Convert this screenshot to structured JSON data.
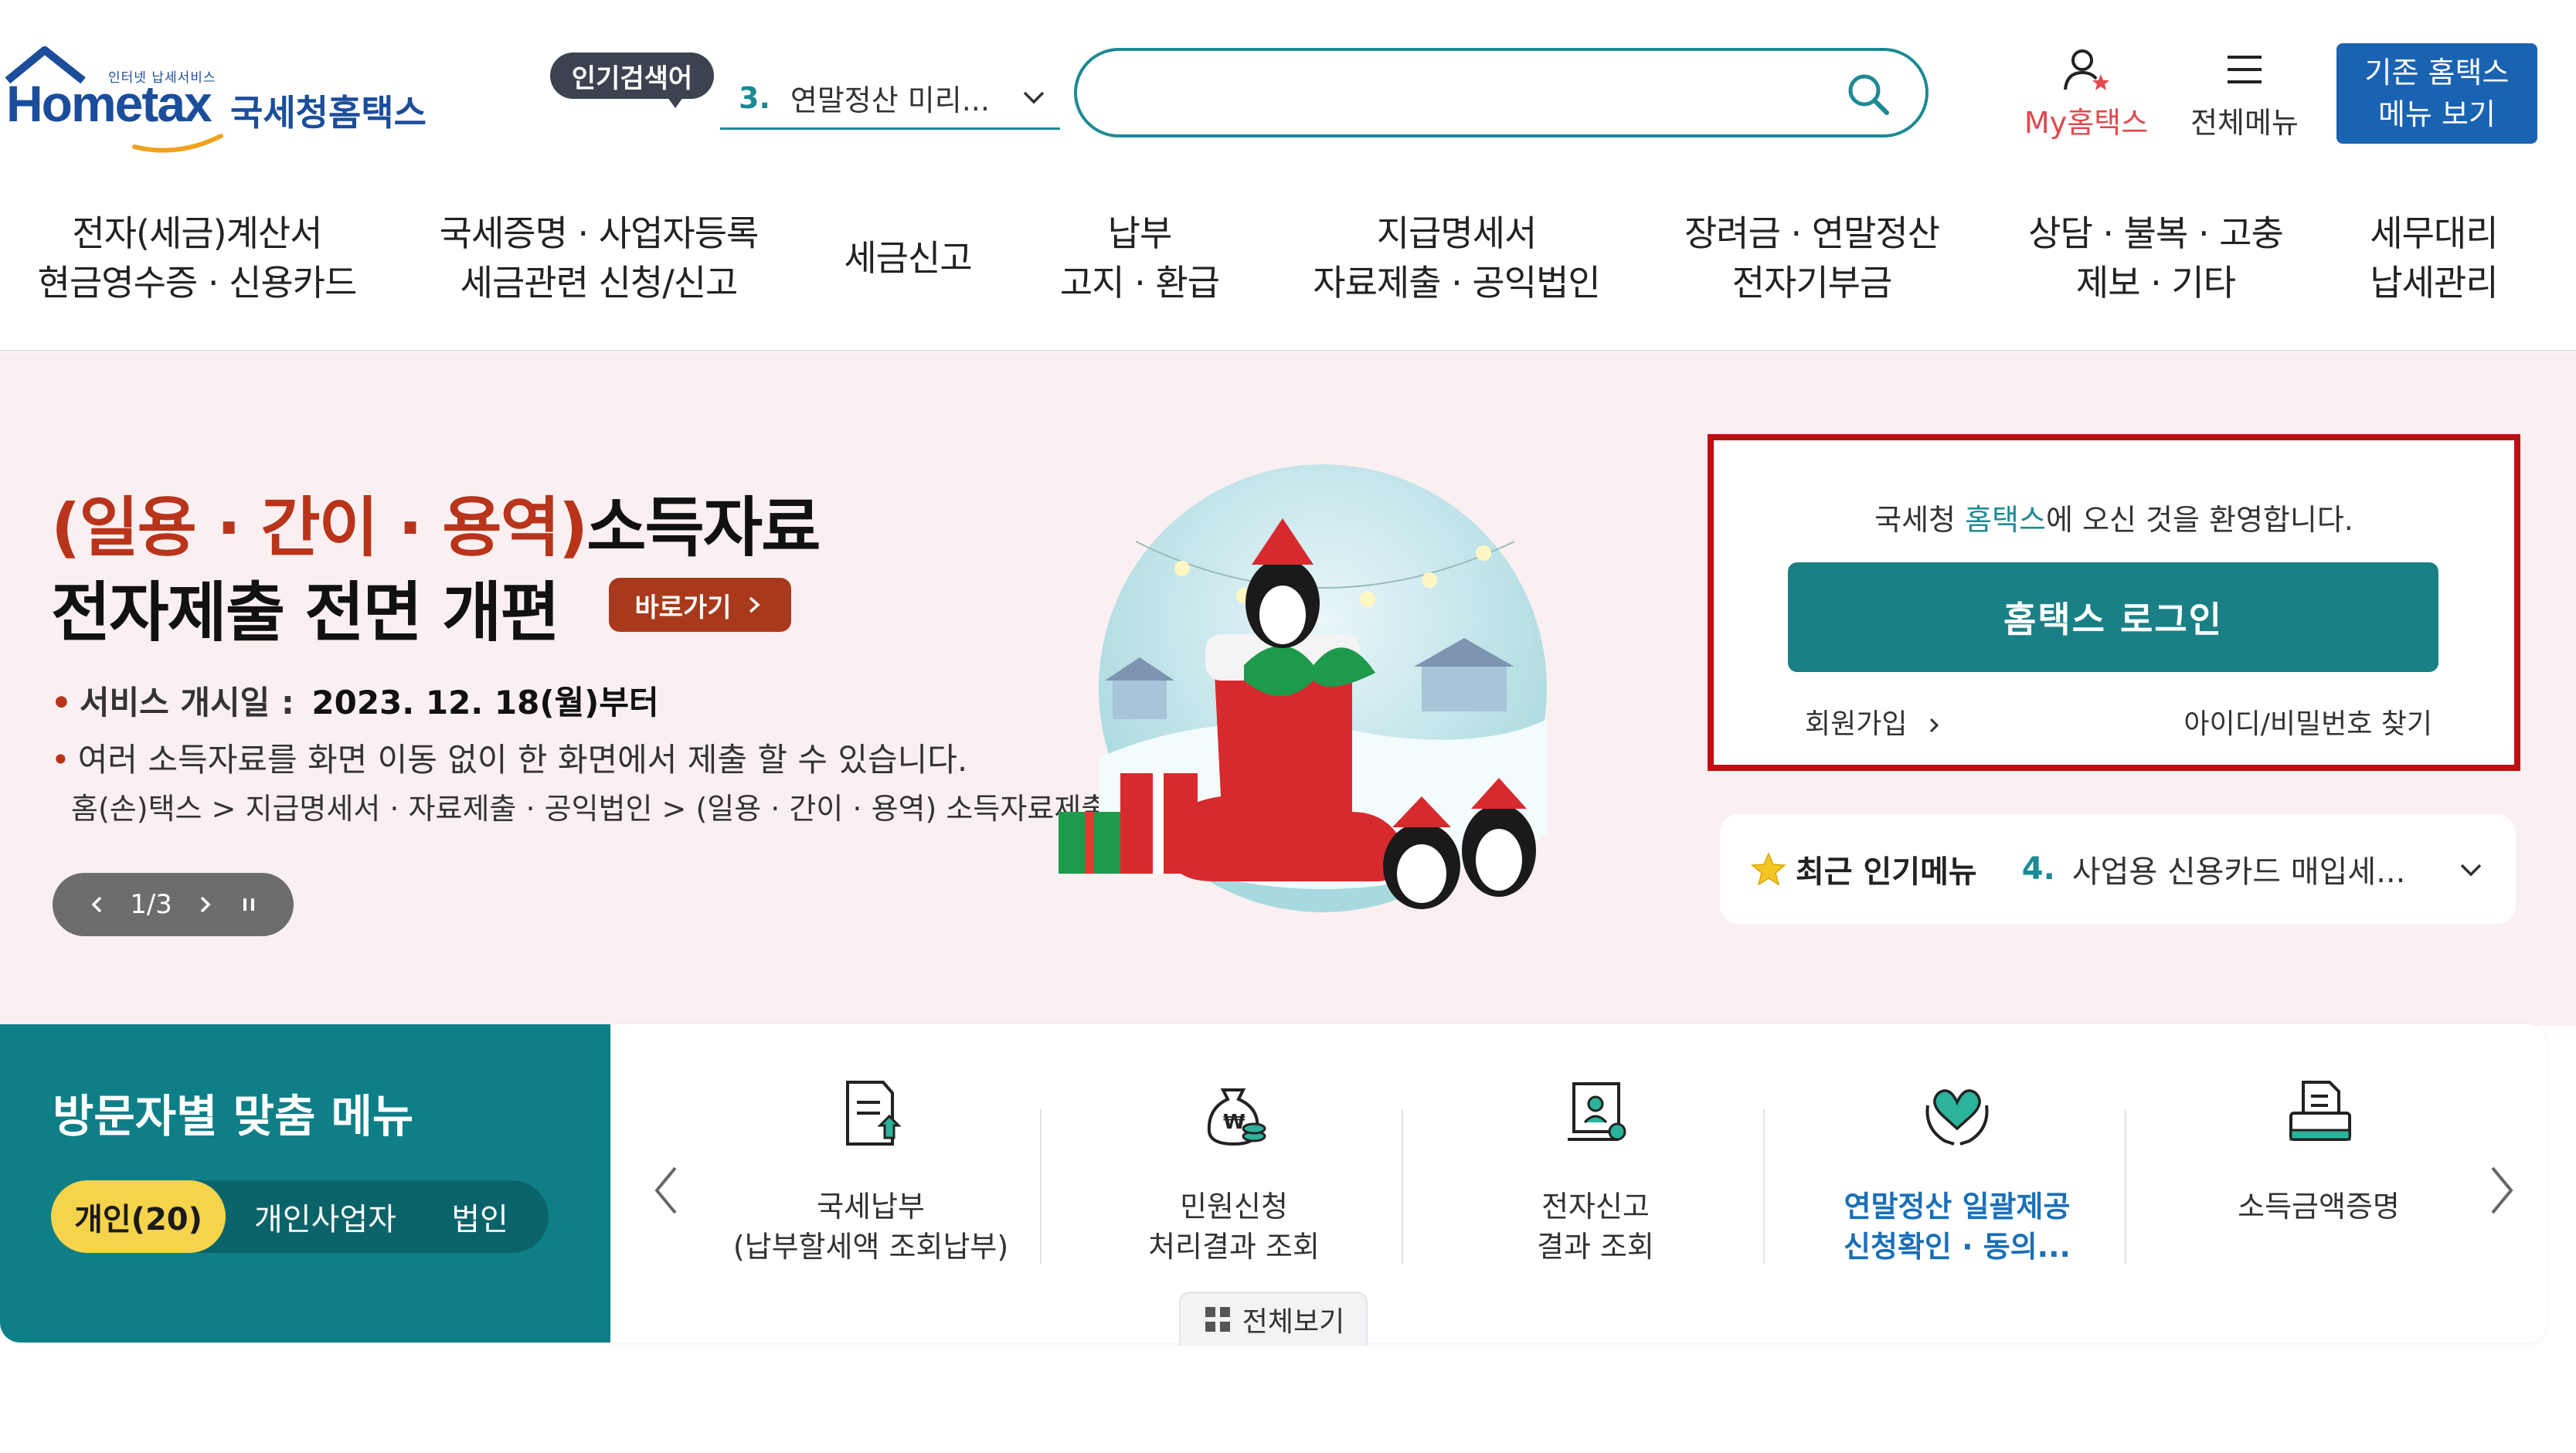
{
  "header": {
    "logo_small": "인터넷 납세서비스",
    "logo_word": "Hometax",
    "logo_name": "국세청홈택스",
    "popular_badge": "인기검색어",
    "popular_rank": "3.",
    "popular_text": "연말정산 미리...",
    "search_placeholder": "",
    "my_hometax": "My홈택스",
    "all_menu": "전체메뉴",
    "legacy_line1": "기존 홈택스",
    "legacy_line2": "메뉴 보기"
  },
  "gnb": [
    {
      "l1": "전자(세금)계산서",
      "l2": "현금영수증 · 신용카드"
    },
    {
      "l1": "국세증명 · 사업자등록",
      "l2": "세금관련 신청/신고"
    },
    {
      "l1": "세금신고",
      "l2": ""
    },
    {
      "l1": "납부",
      "l2": "고지 · 환급"
    },
    {
      "l1": "지급명세서",
      "l2": "자료제출 · 공익법인"
    },
    {
      "l1": "장려금 · 연말정산",
      "l2": "전자기부금"
    },
    {
      "l1": "상담 · 불복 · 고충",
      "l2": "제보 · 기타"
    },
    {
      "l1": "세무대리",
      "l2": "납세관리"
    }
  ],
  "hero": {
    "title_accent": "(일용 · 간이 · 용역)",
    "title_rest": "소득자료",
    "title_line2": "전자제출 전면 개편",
    "go_button": "바로가기",
    "bullet1_label": "서비스 개시일 :",
    "bullet1_date": "2023. 12. 18(월)부터",
    "bullet2": "여러 소득자료를 화면 이동 없이 한 화면에서 제출 할 수 있습니다.",
    "path": "홈(손)택스 > 지급명세서 · 자료제출 · 공익법인 > (일용 · 간이 · 용역) 소득자료제출",
    "slide_indicator": "1/3"
  },
  "login": {
    "welcome_pre": "국세청 ",
    "welcome_hl": "홈택스",
    "welcome_post": "에 오신 것을 환영합니다.",
    "login_button": "홈택스 로그인",
    "join": "회원가입",
    "find": "아이디/비밀번호 찾기",
    "highlight_color": "#c00e13"
  },
  "recent": {
    "title": "최근 인기메뉴",
    "rank": "4.",
    "text": "사업용 신용카드 매입세..."
  },
  "visitor": {
    "title": "방문자별 맞춤 메뉴",
    "tabs": [
      "개인(20)",
      "개인사업자",
      "법인"
    ],
    "active_tab": 0
  },
  "quick_menu": [
    {
      "icon": "tax-payment-icon",
      "l1": "국세납부",
      "l2": "(납부할세액 조회납부)",
      "highlight": false
    },
    {
      "icon": "money-bag-icon",
      "l1": "민원신청",
      "l2": "처리결과 조회",
      "highlight": false
    },
    {
      "icon": "e-filing-icon",
      "l1": "전자신고",
      "l2": "결과 조회",
      "highlight": false
    },
    {
      "icon": "heart-hands-icon",
      "l1": "연말정산 일괄제공",
      "l2": "신청확인 · 동의...",
      "highlight": true
    },
    {
      "icon": "printer-doc-icon",
      "l1": "소득금액증명",
      "l2": "",
      "highlight": false
    }
  ],
  "view_all": "전체보기",
  "colors": {
    "teal": "#1c8a94",
    "brand_blue": "#1b4d9b",
    "hero_bg": "#fbf0f1",
    "visitor_bg": "#0f7f87"
  }
}
